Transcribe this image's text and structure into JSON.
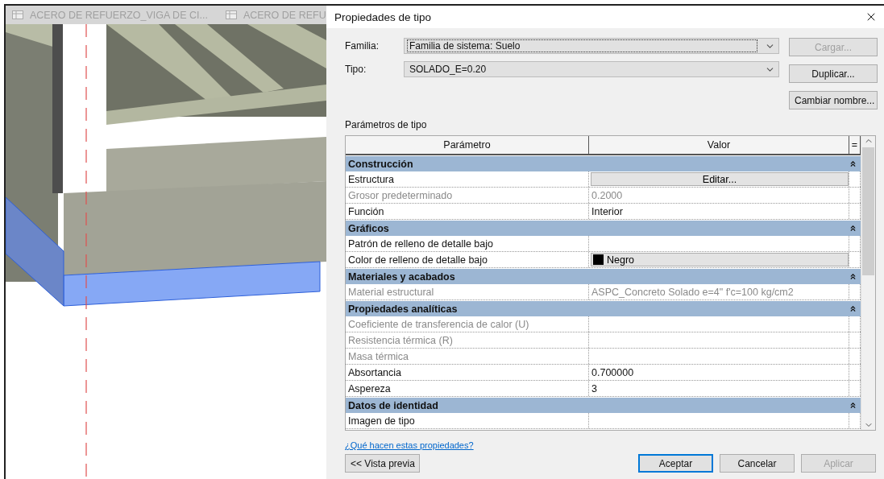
{
  "view_tabs": [
    {
      "label": "ACERO DE REFUERZO_VIGA DE CI..."
    },
    {
      "label": "ACERO DE REFU"
    }
  ],
  "dialog": {
    "title": "Propiedades de tipo",
    "fields": [
      {
        "label": "Familia:",
        "value": "Familia de sistema: Suelo",
        "focused": true
      },
      {
        "label": "Tipo:",
        "value": "SOLADO_E=0.20",
        "focused": false
      }
    ],
    "side_buttons": [
      {
        "label": "Cargar...",
        "disabled": true
      },
      {
        "label": "Duplicar...",
        "disabled": false
      },
      {
        "label": "Cambiar nombre...",
        "disabled": false
      }
    ],
    "section_label": "Parámetros de tipo",
    "table": {
      "columns": [
        "Parámetro",
        "Valor",
        "="
      ],
      "rows": [
        {
          "kind": "group",
          "label": "Construcción",
          "expanded": true
        },
        {
          "kind": "param",
          "name": "Estructura",
          "disabled": false,
          "value": {
            "kind": "button",
            "text": "Editar..."
          }
        },
        {
          "kind": "param",
          "name": "Grosor predeterminado",
          "disabled": true,
          "value": {
            "kind": "text",
            "text": "0.2000"
          }
        },
        {
          "kind": "param",
          "name": "Función",
          "disabled": false,
          "value": {
            "kind": "text",
            "text": "Interior"
          }
        },
        {
          "kind": "group",
          "label": "Gráficos",
          "expanded": true
        },
        {
          "kind": "param",
          "name": "Patrón de relleno de detalle bajo",
          "disabled": false
        },
        {
          "kind": "param",
          "name": "Color de relleno de detalle bajo",
          "disabled": false,
          "value": {
            "kind": "color",
            "text": "Negro",
            "color": "#000000"
          }
        },
        {
          "kind": "group",
          "label": "Materiales y acabados",
          "expanded": true
        },
        {
          "kind": "param",
          "name": "Material estructural",
          "disabled": true,
          "value": {
            "kind": "text",
            "text": "ASPC_Concreto Solado e=4\" f'c=100 kg/cm2"
          }
        },
        {
          "kind": "group",
          "label": "Propiedades analíticas",
          "expanded": true
        },
        {
          "kind": "param",
          "name": "Coeficiente de transferencia de calor (U)",
          "disabled": true
        },
        {
          "kind": "param",
          "name": "Resistencia térmica (R)",
          "disabled": true
        },
        {
          "kind": "param",
          "name": "Masa térmica",
          "disabled": true
        },
        {
          "kind": "param",
          "name": "Absortancia",
          "disabled": false,
          "value": {
            "kind": "text",
            "text": "0.700000"
          }
        },
        {
          "kind": "param",
          "name": "Aspereza",
          "disabled": false,
          "value": {
            "kind": "text",
            "text": "3"
          }
        },
        {
          "kind": "group",
          "label": "Datos de identidad",
          "expanded": true
        },
        {
          "kind": "param",
          "name": "Imagen de tipo",
          "disabled": false
        }
      ]
    },
    "help_link": "¿Qué hacen estas propiedades?",
    "footer": {
      "left_buttons": [
        {
          "label": "<< Vista previa",
          "default": false,
          "disabled": false
        }
      ],
      "right_buttons": [
        {
          "label": "Aceptar",
          "default": true,
          "disabled": false
        },
        {
          "label": "Cancelar",
          "default": false,
          "disabled": false
        },
        {
          "label": "Aplicar",
          "default": false,
          "disabled": true
        }
      ]
    }
  }
}
